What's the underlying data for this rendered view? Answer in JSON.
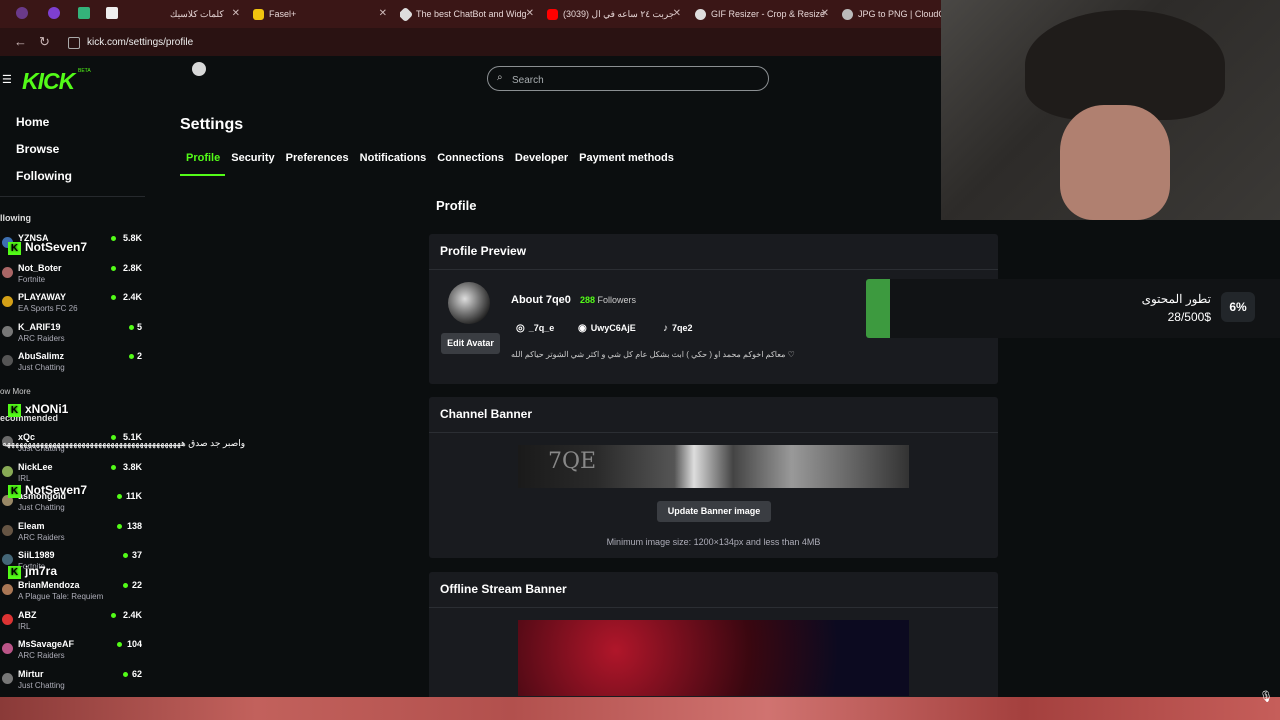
{
  "browser": {
    "tabs": [
      {
        "label": "كلمات كلاسيك",
        "color": "#e8e8e8"
      },
      {
        "label": "Fasel+",
        "color": "#f1c40f"
      },
      {
        "label": "The best ChatBot and Widg",
        "color": "#dddddd"
      },
      {
        "label": "جربت ٢٤ ساعه في ال (3039)",
        "color": "#ff0000"
      },
      {
        "label": "GIF Resizer - Crop & Resize",
        "color": "#dddddd"
      },
      {
        "label": "JPG to PNG | CloudCon",
        "color": "#bbbbbb"
      }
    ],
    "url": "kick.com/settings/profile"
  },
  "header": {
    "logo": "KICK",
    "beta": "BETA",
    "search_placeholder": "Search"
  },
  "sidebar": {
    "nav": [
      {
        "label": "Home",
        "icon": "home-icon"
      },
      {
        "label": "Browse",
        "icon": "browse-icon"
      },
      {
        "label": "Following",
        "icon": "heart-icon"
      }
    ],
    "following_label": "llowing",
    "following": [
      {
        "name": "YZNSA",
        "category": "",
        "viewers": "5.8K",
        "avatar": "#3d6fb0"
      },
      {
        "name": "Not_Boter",
        "category": "Fortnite",
        "viewers": "2.8K",
        "avatar": "#a66"
      },
      {
        "name": "PLAYAWAY",
        "category": "EA Sports FC 26",
        "viewers": "2.4K",
        "avatar": "#d4a017"
      },
      {
        "name": "K_ARIF19",
        "category": "ARC Raiders",
        "viewers": "5",
        "avatar": "#777"
      },
      {
        "name": "AbuSalimz",
        "category": "Just Chatting",
        "viewers": "2",
        "avatar": "#555"
      }
    ],
    "show_more": "ow More",
    "recommended_label": "ecommended",
    "recommended": [
      {
        "name": "xQc",
        "category": "Just Chatting",
        "viewers": "5.1K",
        "avatar": "#6a6a6a"
      },
      {
        "name": "NickLee",
        "category": "IRL",
        "viewers": "3.8K",
        "avatar": "#8a5"
      },
      {
        "name": "asmongold",
        "category": "Just Chatting",
        "viewers": "11K",
        "avatar": "#986"
      },
      {
        "name": "Eleam",
        "category": "ARC Raiders",
        "viewers": "138",
        "avatar": "#654"
      },
      {
        "name": "SiiL1989",
        "category": "Fortnite",
        "viewers": "37",
        "avatar": "#467"
      },
      {
        "name": "BrianMendoza",
        "category": "A Plague Tale: Requiem",
        "viewers": "22",
        "avatar": "#a75"
      },
      {
        "name": "ABZ",
        "category": "IRL",
        "viewers": "2.4K",
        "avatar": "#d33"
      },
      {
        "name": "MsSavageAF",
        "category": "ARC Raiders",
        "viewers": "104",
        "avatar": "#b58"
      },
      {
        "name": "Mirtur",
        "category": "Just Chatting",
        "viewers": "62",
        "avatar": "#777"
      }
    ]
  },
  "overlay": {
    "names": [
      "NotSeven7",
      "xNONi1",
      "NotSeven7",
      "jm7ra"
    ],
    "chat_line": "واصبر جد صدق هههههههههههههههههههههههههههههههههههههههههههه"
  },
  "settings": {
    "title": "Settings",
    "tabs": [
      "Profile",
      "Security",
      "Preferences",
      "Notifications",
      "Connections",
      "Developer",
      "Payment methods"
    ],
    "active_tab": "Profile",
    "section_title": "Profile",
    "preview": {
      "title": "Profile Preview",
      "about": "About 7qe0",
      "followers_count": "288",
      "followers_label": "Followers",
      "edit_avatar": "Edit Avatar",
      "instagram": "_7q_e",
      "discord": "UwyC6AjE",
      "tiktok": "7qe2",
      "bio": "معاكم اخوكم محمد او ( حكي ) ابث بشكل عام كل شي و اكثر شي الشوتر حياكم الله ♡"
    },
    "channel_banner": {
      "title": "Channel Banner",
      "banner_text": "7QE",
      "button": "Update Banner image",
      "hint": "Minimum image size: 1200×134px and less than 4MB"
    },
    "offline_banner": {
      "title": "Offline Stream Banner"
    }
  },
  "goal": {
    "title": "تطور المحتوى",
    "value": "28/500$",
    "percent": "6%",
    "progress": 0.06
  },
  "colors": {
    "accent": "#53fc18",
    "bg": "#0b0e0f",
    "card": "#191b1f"
  }
}
